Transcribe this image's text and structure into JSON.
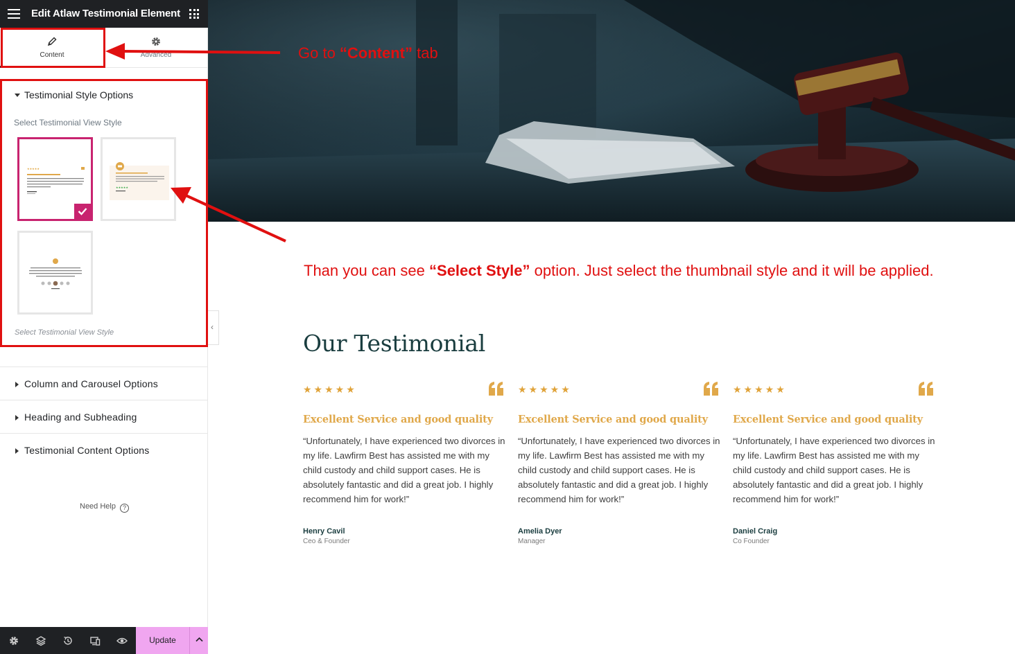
{
  "editor": {
    "title": "Edit Atlaw Testimonial Element",
    "tabs": [
      {
        "label": "Content",
        "icon": "pencil-icon",
        "active": true
      },
      {
        "label": "Advanced",
        "icon": "gear-icon",
        "active": false
      }
    ],
    "style_section": {
      "title": "Testimonial Style Options",
      "select_label": "Select Testimonial View Style",
      "thumbnails": [
        {
          "name": "style-1",
          "selected": true
        },
        {
          "name": "style-2",
          "selected": false
        },
        {
          "name": "style-3",
          "selected": false
        }
      ],
      "help_text": "Select Testimonial View Style"
    },
    "sections": [
      {
        "label": "Column and Carousel Options"
      },
      {
        "label": "Heading and Subheading"
      },
      {
        "label": "Testimonial Content Options"
      }
    ],
    "need_help": "Need Help",
    "footer": {
      "icons": [
        "settings-icon",
        "layers-icon",
        "history-icon",
        "responsive-icon",
        "preview-eye-icon"
      ],
      "update_label": "Update"
    }
  },
  "annotations": {
    "tab_note": {
      "prefix": "Go  to ",
      "bold": "“Content”",
      "suffix": " tab"
    },
    "style_note": {
      "prefix": "Than you can see ",
      "bold": "“Select Style”",
      "suffix": " option. Just select the thumbnail style and it will be applied."
    },
    "color": "#e01010"
  },
  "preview": {
    "heading": "Our Testimonial",
    "accent_color": "#e0a84a",
    "cards": [
      {
        "rating": "★★★★★",
        "title": "Excellent Service and good quality",
        "text": "“Unfortunately, I have experienced two divorces in my life. Lawfirm Best has assisted me with my child custody and child support cases. He is absolutely fantastic and did a great job. I highly recommend him for work!”",
        "name": "Henry Cavil",
        "role": "Ceo & Founder"
      },
      {
        "rating": "★★★★★",
        "title": "Excellent Service and good quality",
        "text": "“Unfortunately, I have experienced two divorces in my life. Lawfirm Best has assisted me with my child custody and child support cases. He is absolutely fantastic and did a great job. I highly recommend him for work!”",
        "name": "Amelia Dyer",
        "role": "Manager"
      },
      {
        "rating": "★★★★★",
        "title": "Excellent Service and good quality",
        "text": "“Unfortunately, I have experienced two divorces in my life. Lawfirm Best has assisted me with my child custody and child support cases. He is absolutely fantastic and did a great job. I highly recommend him for work!”",
        "name": "Daniel Craig",
        "role": "Co Founder"
      }
    ]
  }
}
